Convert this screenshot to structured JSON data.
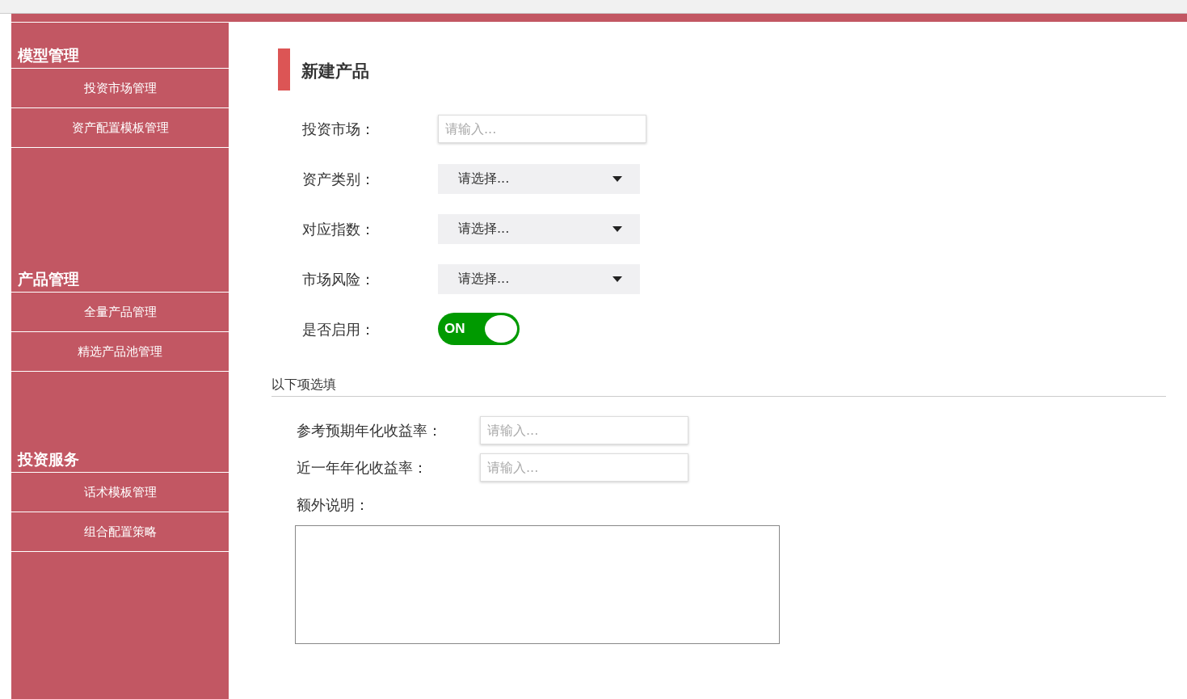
{
  "sidebar": {
    "sections": [
      {
        "title": "模型管理",
        "items": [
          {
            "label": "投资市场管理"
          },
          {
            "label": "资产配置模板管理"
          }
        ]
      },
      {
        "title": "产品管理",
        "items": [
          {
            "label": "全量产品管理"
          },
          {
            "label": "精选产品池管理"
          }
        ]
      },
      {
        "title": "投资服务",
        "items": [
          {
            "label": "话术模板管理"
          },
          {
            "label": "组合配置策略"
          }
        ]
      }
    ]
  },
  "form": {
    "title": "新建产品",
    "fields": [
      {
        "kind": "input",
        "label": "投资市场：",
        "placeholder": "请输入..."
      },
      {
        "kind": "select",
        "label": "资产类别：",
        "value": "请选择..."
      },
      {
        "kind": "select",
        "label": "对应指数：",
        "value": "请选择..."
      },
      {
        "kind": "select",
        "label": "市场风险：",
        "value": "请选择..."
      },
      {
        "kind": "toggle",
        "label": "是否启用：",
        "on": true,
        "text": "ON"
      }
    ]
  },
  "optional": {
    "heading": "以下项选填",
    "fields": [
      {
        "kind": "input",
        "label": "参考预期年化收益率：",
        "placeholder": "请输入..."
      },
      {
        "kind": "input",
        "label": "近一年年化收益率：",
        "placeholder": "请输入..."
      },
      {
        "kind": "textarea",
        "label": "额外说明："
      }
    ]
  }
}
